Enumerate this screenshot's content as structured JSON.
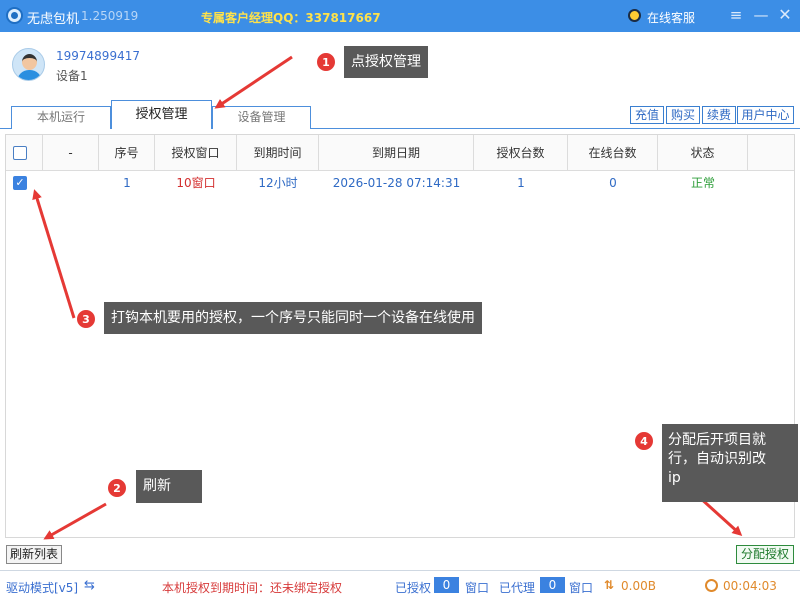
{
  "window": {
    "app_name": "无虑包机",
    "version": "1.250919",
    "qq_contact": "专属客户经理QQ：337817667",
    "online_service": "在线客服",
    "menu_icon": "menu-icon",
    "minimize_icon": "minimize-icon",
    "close_icon": "close-icon",
    "accent_color": "#3c8ee6"
  },
  "account": {
    "number": "19974899417",
    "device": "设备1"
  },
  "tabs": [
    {
      "label": "本机运行",
      "active": false
    },
    {
      "label": "授权管理",
      "active": true
    },
    {
      "label": "设备管理",
      "active": false
    }
  ],
  "toolbar": {
    "recharge": "充值",
    "buy": "购买",
    "renew": "续费",
    "user_center": "用户中心"
  },
  "grid": {
    "columns": [
      "-",
      "序号",
      "授权窗口",
      "到期时间",
      "到期日期",
      "授权台数",
      "在线台数",
      "状态"
    ],
    "rows": [
      {
        "checked": true,
        "dash": "",
        "index": "1",
        "window": "10窗口",
        "duration": "12小时",
        "expire_date": "2026-01-28 07:14:31",
        "auth_count": "1",
        "online_count": "0",
        "status": "正常"
      }
    ]
  },
  "annotations": [
    {
      "number": "1",
      "text": "点授权管理"
    },
    {
      "number": "2",
      "text": "刷新"
    },
    {
      "number": "3",
      "text": "打钩本机要用的授权，一个序号只能同时一个设备在线使用"
    },
    {
      "number": "4",
      "text_lines": [
        "分配后开项目就",
        "行，自动识别改",
        "ip"
      ]
    }
  ],
  "buttons": {
    "refresh_list": "刷新列表",
    "assign_auth": "分配授权"
  },
  "status": {
    "driver_mode": "驱动模式[v5]",
    "auth_expire": "本机授权到期时间：还未绑定授权",
    "authorized_label": "已授权",
    "authorized_count": "0",
    "authorized_unit": "窗口",
    "agent_label": "已代理",
    "agent_count": "0",
    "agent_unit": "窗口",
    "traffic": "0.00B",
    "timer": "00:04:03"
  }
}
